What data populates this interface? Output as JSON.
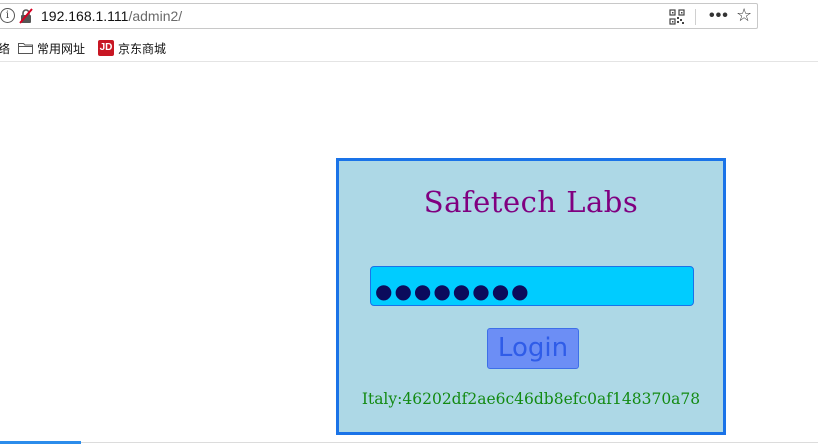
{
  "browser": {
    "url_host": "192.168.1.111",
    "url_path": "/admin2/",
    "icons": {
      "info": "info-icon",
      "insecure": "insecure-connection-icon",
      "qr": "qr-code-icon",
      "more": "more-actions-icon",
      "star": "bookmark-star-icon"
    },
    "info_glyph": "i",
    "more_glyph": "•••",
    "star_glyph": "☆"
  },
  "bookmarks": {
    "cut_label": "络",
    "items": [
      {
        "label": "常用网址",
        "icon": "folder-icon"
      },
      {
        "label": "京东商城",
        "icon": "jd-icon",
        "badge": "JD"
      }
    ]
  },
  "login": {
    "title": "Safetech Labs",
    "password_value": "●●●●●●●●",
    "button_label": "Login",
    "flag_text": "Italy:46202df2ae6c46db8efc0af148370a78",
    "colors": {
      "panel_bg": "#add8e6",
      "panel_border": "#1a73e8",
      "title": "#800080",
      "input_bg": "#00ccff",
      "button_bg": "#6c8ef5",
      "flag": "#138a13"
    }
  }
}
